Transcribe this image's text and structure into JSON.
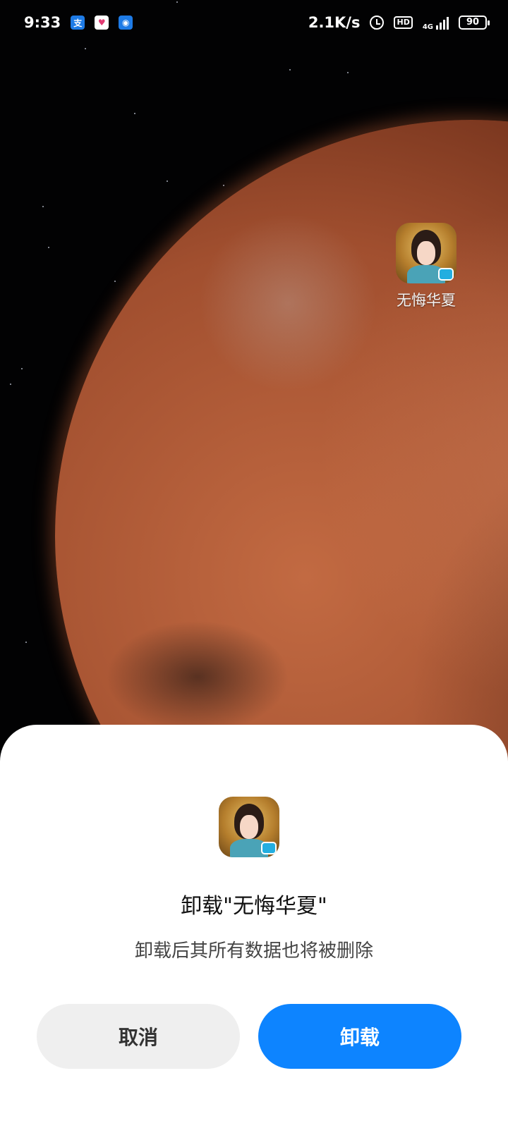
{
  "status_bar": {
    "time": "9:33",
    "notification_icons": [
      "alipay-icon",
      "heart-app-icon",
      "hotspot-icon"
    ],
    "net_speed": "2.1K/s",
    "net_type": "4G",
    "hd_label": "HD",
    "battery": "90"
  },
  "desktop": {
    "app_label": "无悔华夏"
  },
  "uninstall_dialog": {
    "title": "卸载\"无悔华夏\"",
    "message": "卸载后其所有数据也将被删除",
    "cancel_label": "取消",
    "confirm_label": "卸载"
  },
  "colors": {
    "confirm_button": "#0d84ff",
    "cancel_button": "#efefef",
    "sheet_background": "#ffffff"
  }
}
